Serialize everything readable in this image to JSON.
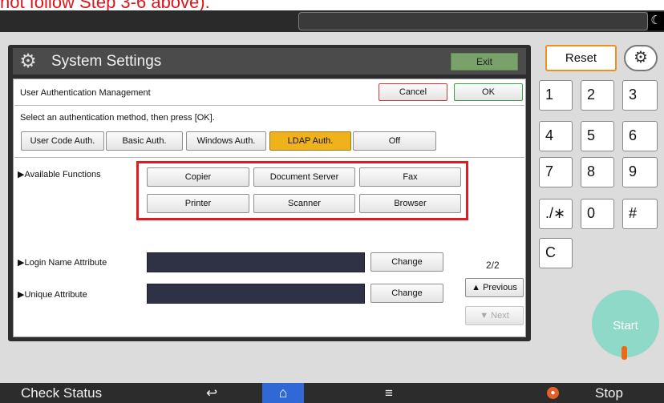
{
  "caption": "not follow Step 3-6 above).",
  "window": {
    "title": "System Settings",
    "exit_label": "Exit"
  },
  "form": {
    "section_title": "User Authentication Management",
    "cancel_label": "Cancel",
    "ok_label": "OK",
    "instruction": "Select an authentication method, then press [OK].",
    "auth_methods": [
      "User Code Auth.",
      "Basic Auth.",
      "Windows Auth.",
      "LDAP Auth.",
      "Off"
    ],
    "selected_method": "LDAP Auth.",
    "available_functions_label": "▶Available Functions",
    "functions": [
      "Copier",
      "Document Server",
      "Fax",
      "Printer",
      "Scanner",
      "Browser"
    ],
    "login_name_label": "▶Login Name Attribute",
    "unique_attr_label": "▶Unique Attribute",
    "change_label": "Change",
    "page_indicator": "2/2",
    "previous_label": "▲ Previous",
    "next_label": "▼ Next"
  },
  "side": {
    "reset_label": "Reset",
    "keys": [
      "1",
      "2",
      "3",
      "4",
      "5",
      "6",
      "7",
      "8",
      "9",
      "./∗",
      "0",
      "#",
      "C"
    ],
    "start_label": "Start"
  },
  "bottom": {
    "check_status_label": "Check Status",
    "back_symbol": "↩",
    "home_symbol": "⌂",
    "menu_symbol": "≡",
    "stop_label": "Stop"
  },
  "colors": {
    "selected_method": "#f0b21b",
    "highlight_box": "#e11b22",
    "reset_border": "#f28e1d",
    "start_button": "#8fd9c9",
    "home_button": "#3069d6"
  }
}
